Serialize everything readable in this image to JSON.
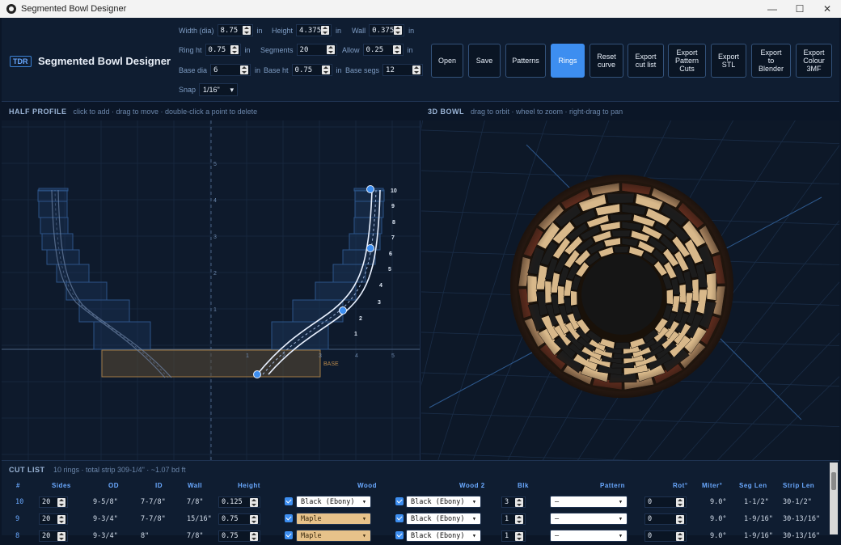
{
  "window": {
    "title": "Segmented Bowl Designer",
    "minimize": "—",
    "maximize": "☐",
    "close": "✕"
  },
  "app": {
    "badge": "TDR",
    "title": "Segmented Bowl Designer"
  },
  "params": {
    "width": {
      "label": "Width (dia)",
      "value": "8.75",
      "unit": "in"
    },
    "height": {
      "label": "Height",
      "value": "4.375",
      "unit": "in"
    },
    "wall": {
      "label": "Wall",
      "value": "0.375",
      "unit": "in"
    },
    "ring_ht": {
      "label": "Ring ht",
      "value": "0.75",
      "unit": "in"
    },
    "segments": {
      "label": "Segments",
      "value": "20"
    },
    "allow": {
      "label": "Allow",
      "value": "0.25",
      "unit": "in"
    },
    "base_dia": {
      "label": "Base dia",
      "value": "6",
      "unit": "in"
    },
    "base_ht": {
      "label": "Base ht",
      "value": "0.75",
      "unit": "in"
    },
    "base_segs": {
      "label": "Base segs",
      "value": "12"
    },
    "snap": {
      "label": "Snap",
      "value": "1/16\""
    }
  },
  "toolbar": {
    "open": "Open",
    "save": "Save",
    "patterns": "Patterns",
    "rings": "Rings",
    "reset_curve": "Reset curve",
    "export_cut_list": "Export cut list",
    "export_pattern_cuts": "Export Pattern Cuts",
    "export_stl": "Export STL",
    "export_blender": "Export to Blender",
    "export_colour_3mf": "Export Colour 3MF"
  },
  "half_profile": {
    "title": "HALF PROFILE",
    "hint": "click to add · drag to move · double-click a point to delete",
    "ring_labels": [
      "1",
      "2",
      "3",
      "4",
      "5",
      "6",
      "7",
      "8",
      "9",
      "10"
    ],
    "x_ticks": [
      "1",
      "2",
      "3",
      "4",
      "5"
    ],
    "y_ticks": [
      "1",
      "2",
      "3",
      "4",
      "5"
    ],
    "base_label": "BASE"
  },
  "bowl_3d": {
    "title": "3D BOWL",
    "hint": "drag to orbit · wheel to zoom · right-drag to pan"
  },
  "cut_list": {
    "title": "CUT LIST",
    "summary": "10 rings · total strip 309-1/4\" · ~1.07 bd ft",
    "headers": [
      "#",
      "Sides",
      "OD",
      "ID",
      "Wall",
      "Height",
      "Wood",
      "Wood 2",
      "Blk",
      "Pattern",
      "Rot°",
      "Miter°",
      "Seg Len",
      "Strip Len"
    ],
    "rows": [
      {
        "n": "10",
        "sides": "20",
        "od": "9-5/8\"",
        "id": "7-7/8\"",
        "wall": "7/8\"",
        "height": "0.125",
        "wood": "Black (Ebony)",
        "wood2": "Black (Ebony)",
        "blk": "3",
        "pattern": "–",
        "rot": "0",
        "miter": "9.0°",
        "seg_len": "1-1/2\"",
        "strip_len": "30-1/2\""
      },
      {
        "n": "9",
        "sides": "20",
        "od": "9-3/4\"",
        "id": "7-7/8\"",
        "wall": "15/16\"",
        "height": "0.75",
        "wood": "Maple",
        "wood2": "Black (Ebony)",
        "blk": "1",
        "pattern": "–",
        "rot": "0",
        "miter": "9.0°",
        "seg_len": "1-9/16\"",
        "strip_len": "30-13/16\""
      },
      {
        "n": "8",
        "sides": "20",
        "od": "9-3/4\"",
        "id": "8\"",
        "wall": "7/8\"",
        "height": "0.75",
        "wood": "Maple",
        "wood2": "Black (Ebony)",
        "blk": "1",
        "pattern": "–",
        "rot": "0",
        "miter": "9.0°",
        "seg_len": "1-9/16\"",
        "strip_len": "30-13/16\""
      }
    ]
  },
  "colors": {
    "accent": "#3d8ef0",
    "maple": "#e7c28a",
    "ebony": "#1a1a1a",
    "background": "#0b1627"
  }
}
